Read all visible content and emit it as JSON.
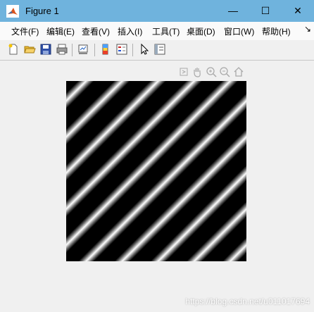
{
  "window": {
    "title": "Figure 1",
    "minimize_glyph": "—",
    "maximize_glyph": "☐",
    "close_glyph": "✕"
  },
  "menu": {
    "items": [
      {
        "label": "文件(F)"
      },
      {
        "label": "编辑(E)"
      },
      {
        "label": "查看(V)"
      },
      {
        "label": "插入(I)"
      },
      {
        "label": "工具(T)"
      },
      {
        "label": "桌面(D)"
      },
      {
        "label": "窗口(W)"
      },
      {
        "label": "帮助(H)"
      }
    ],
    "overflow_glyph": "↘"
  },
  "toolbar": {
    "icons": [
      "new-figure-icon",
      "open-file-icon",
      "save-icon",
      "print-icon",
      "link-plot-icon",
      "colorbar-icon",
      "legend-icon",
      "pointer-icon",
      "property-inspector-icon"
    ]
  },
  "axes_toolbar": {
    "icons": [
      "export-icon",
      "pan-hand-icon",
      "zoom-in-icon",
      "zoom-out-icon",
      "home-icon"
    ]
  },
  "image": {
    "description_colors": {
      "dark": "#000000",
      "light": "#ffffff"
    }
  },
  "watermark": "https://blog.csdn.net/u011017694",
  "colors": {
    "titlebar": "#6fb3dd",
    "menubar": "#fafafa",
    "background": "#f0f0f0"
  }
}
